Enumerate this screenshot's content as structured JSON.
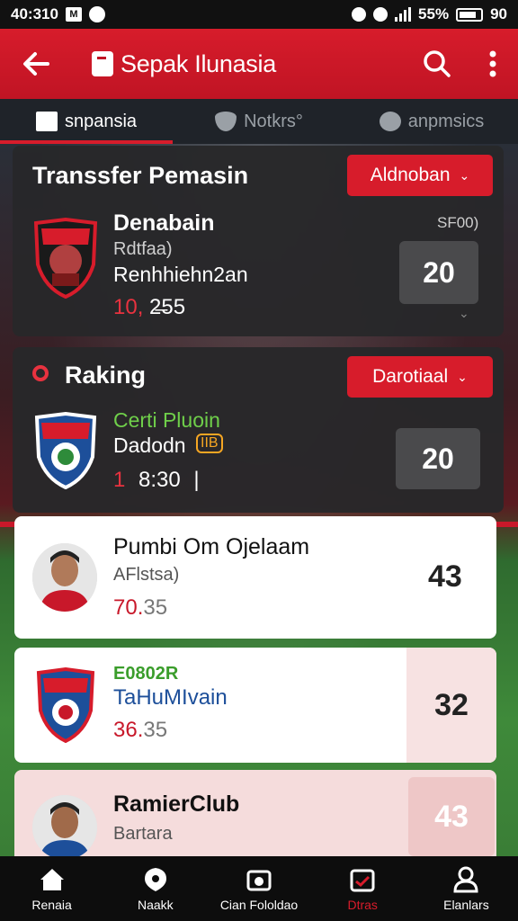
{
  "status_bar": {
    "time": "40:310",
    "right_text": "55%",
    "battery_text": "90"
  },
  "app_bar": {
    "title": "Sepak Ilunasia",
    "back_icon": "arrow-left-icon",
    "search_icon": "search-icon",
    "more_icon": "more-vertical-icon"
  },
  "tabs": [
    {
      "label": "snpansia",
      "active": true,
      "icon": "grid-icon"
    },
    {
      "label": "Notkrs°",
      "active": false,
      "icon": "shield-icon"
    },
    {
      "label": "anpmsics",
      "active": false,
      "icon": "cross-icon"
    }
  ],
  "transfer": {
    "title": "Transsfer Pemasin",
    "filter_label": "Aldnoban",
    "player": {
      "name": "Denabain",
      "sub": "Rdtfaa)",
      "club": "Renhhiehn2an",
      "value_prefix": "10,",
      "value_rest": "2̶55",
      "tag": "SF00)",
      "score": "20"
    }
  },
  "ranking": {
    "title": "Raking",
    "filter_label": "Darotiaal",
    "player": {
      "name_green": "Certi Pluoin",
      "name": "Dadodn",
      "badge": "IIB",
      "time_prefix": "1",
      "time": "8:30",
      "score": "20"
    }
  },
  "list": [
    {
      "name": "Pumbi Om Ojelaam",
      "sub": "AFlstsa)",
      "value_prefix": "70.",
      "value_rest": "35",
      "score": "43"
    },
    {
      "name": "E0802R",
      "sub": "TaHuMIvain",
      "value_prefix": "36.",
      "value_rest": "35",
      "score": "32"
    },
    {
      "name": "RamierClub",
      "sub": "Bartara",
      "value_prefix": "",
      "value_rest": "",
      "score": "43"
    }
  ],
  "bottom_nav": [
    {
      "label": "Renaia",
      "icon": "home-icon",
      "active": false
    },
    {
      "label": "Naakk",
      "icon": "ball-icon",
      "active": false
    },
    {
      "label": "Cian Fololdao",
      "icon": "stadium-icon",
      "active": false
    },
    {
      "label": "Dtras",
      "icon": "calendar-icon",
      "active": true
    },
    {
      "label": "Elanlars",
      "icon": "profile-icon",
      "active": false
    }
  ],
  "colors": {
    "brand_red": "#d71c2b",
    "dark_card": "#28282a",
    "nav_bg": "#0d0d0d"
  }
}
